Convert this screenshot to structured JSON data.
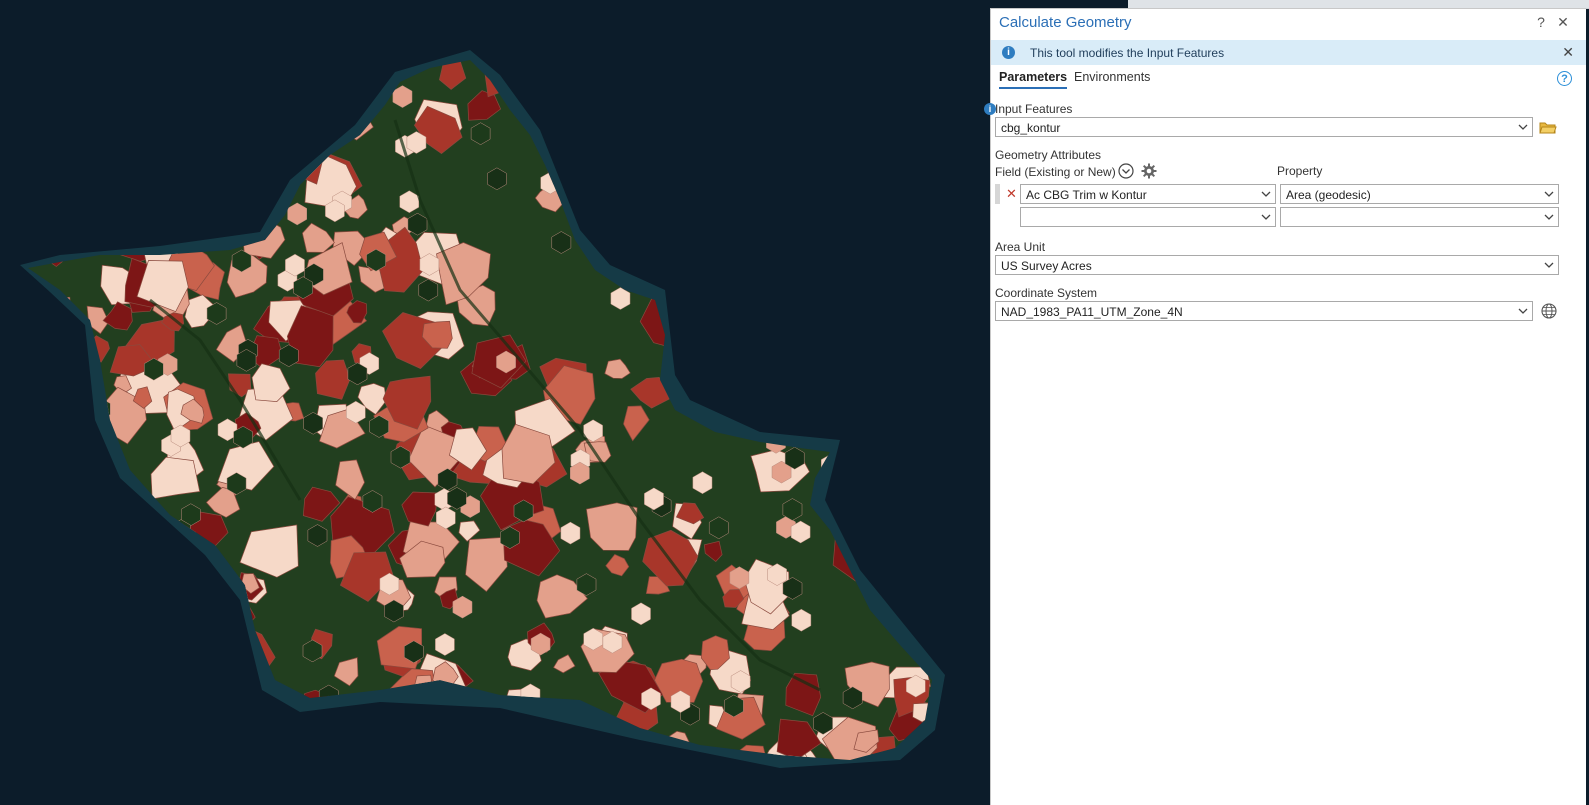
{
  "pane": {
    "title": "Calculate Geometry",
    "help_glyph": "?",
    "close_glyph": "✕",
    "info_message": "This tool modifies the Input Features",
    "tabs": [
      "Parameters",
      "Environments"
    ],
    "input_features": {
      "label": "Input Features",
      "value": "cbg_kontur"
    },
    "geometry_attributes": {
      "label": "Geometry Attributes",
      "field_header": "Field (Existing or New)",
      "property_header": "Property",
      "rows": [
        {
          "field": "Ac CBG Trim w Kontur",
          "property": "Area (geodesic)"
        },
        {
          "field": "",
          "property": ""
        }
      ]
    },
    "area_unit": {
      "label": "Area Unit",
      "value": "US Survey Acres"
    },
    "coordinate_system": {
      "label": "Coordinate System",
      "value": "NAD_1983_PA11_UTM_Zone_4N"
    }
  },
  "map": {
    "ocean_color": "#0c1c2a",
    "vegetation_color": "#1f3d1c",
    "class_colors": [
      "#f6d9c8",
      "#e3a08b",
      "#c9624d",
      "#a8362a",
      "#7d1616"
    ]
  },
  "icons": {
    "info": "info-icon",
    "folder": "open-folder-icon",
    "globe": "globe-icon",
    "gear": "gear-icon",
    "expand": "chevron-circle-icon",
    "remove": "remove-row-icon"
  }
}
